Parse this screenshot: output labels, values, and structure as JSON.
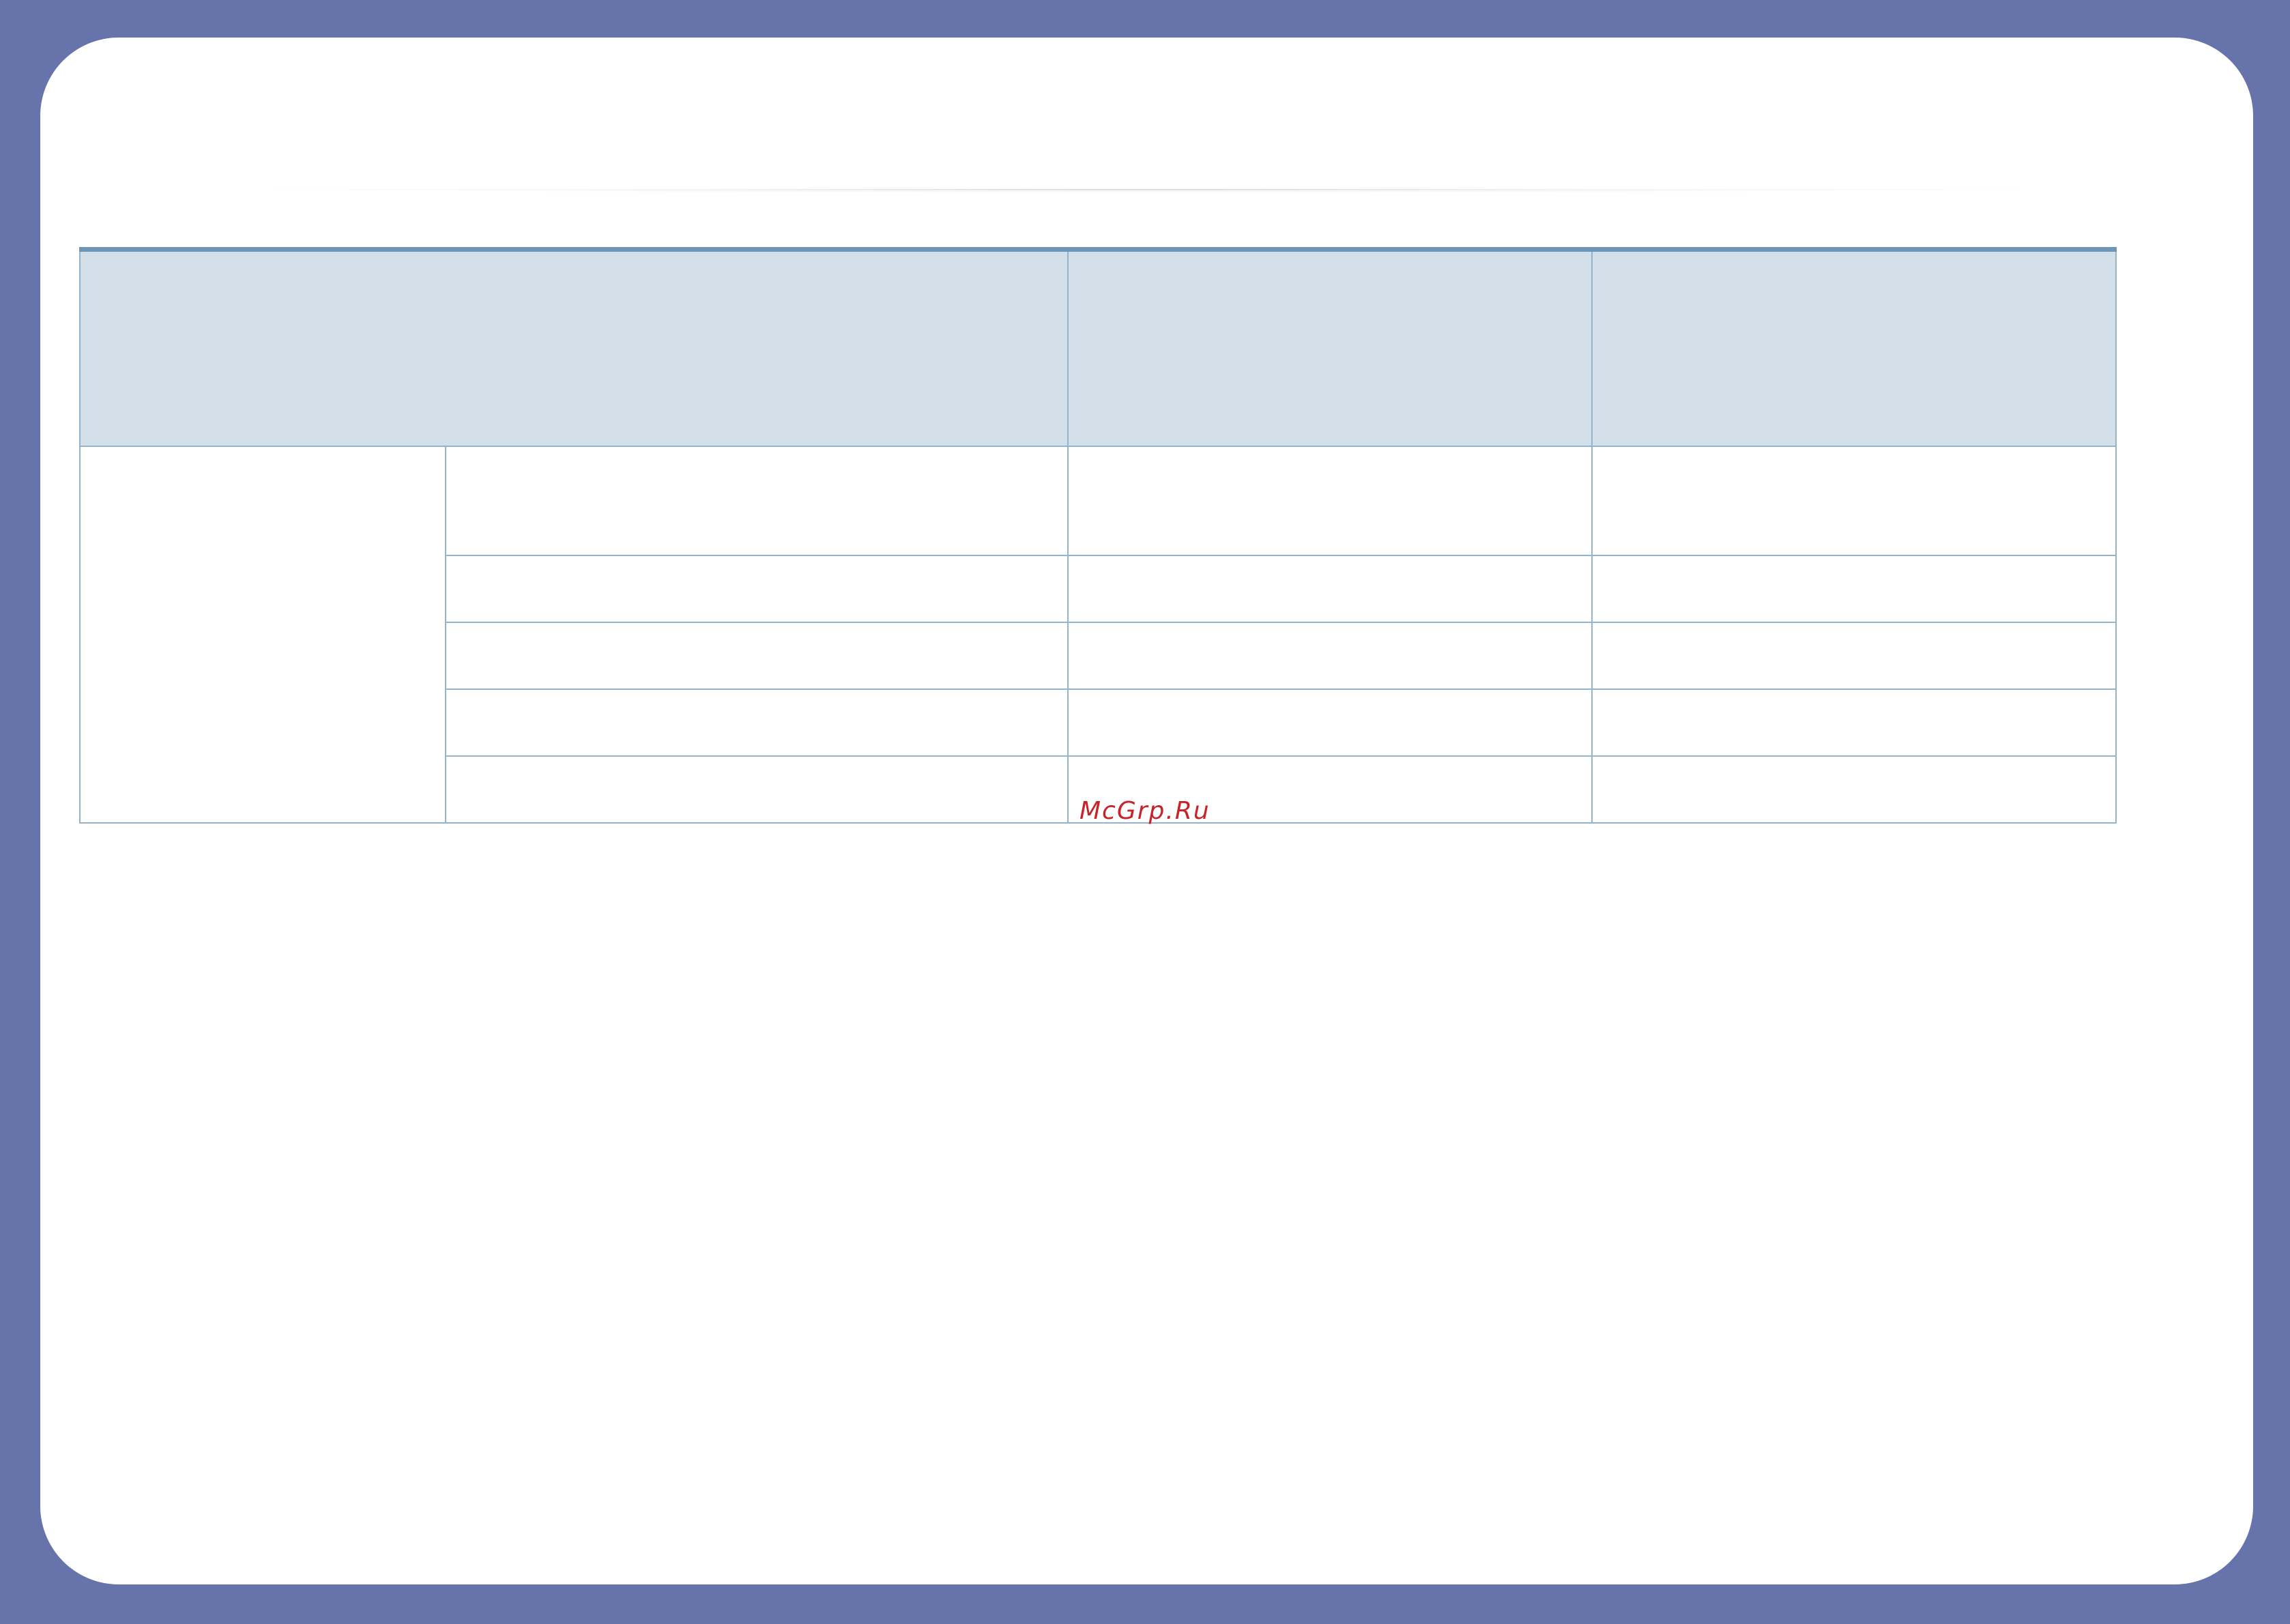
{
  "watermark": {
    "text": "McGrp.Ru",
    "color": "#c8232b"
  },
  "colors": {
    "frame": "#6674ab",
    "table_header_fill": "#d3dfe9",
    "table_border": "#94b3cc",
    "table_top_rule": "#6d96b6"
  },
  "table": {
    "header": [
      "",
      "",
      ""
    ],
    "group_label": "",
    "rows": [
      [
        "",
        "",
        ""
      ],
      [
        "",
        "",
        ""
      ],
      [
        "",
        "",
        ""
      ],
      [
        "",
        "",
        ""
      ],
      [
        "",
        "",
        ""
      ]
    ]
  }
}
